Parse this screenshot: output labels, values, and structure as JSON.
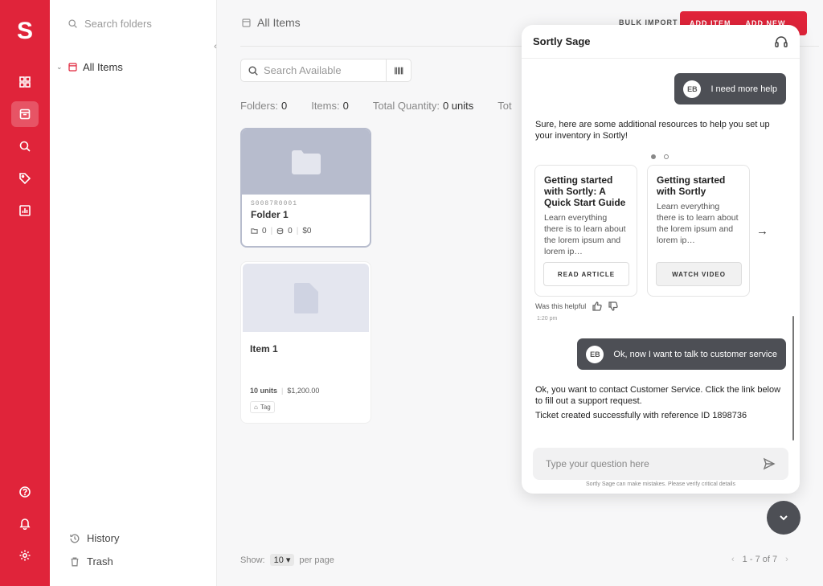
{
  "rail": {
    "logo": "S",
    "icons": [
      "dashboard-icon",
      "items-icon",
      "search-icon",
      "tags-icon",
      "reports-icon",
      "help-icon",
      "notifications-icon",
      "settings-icon"
    ]
  },
  "folders": {
    "search_placeholder": "Search folders",
    "tree_root": "All Items",
    "history": "History",
    "trash": "Trash"
  },
  "main": {
    "title": "All Items",
    "bulk_import": "BULK IMPORT",
    "add_item": "ADD ITEM",
    "add_new": "ADD NEW",
    "search_placeholder": "Search Available",
    "stats": [
      {
        "label": "Folders:",
        "value": "0"
      },
      {
        "label": "Items:",
        "value": "0"
      },
      {
        "label": "Total Quantity:",
        "value": "0 units"
      },
      {
        "label": "Tot",
        "value": ""
      }
    ],
    "cards": [
      {
        "id": "S0087R0001",
        "title": "Folder 1",
        "folders": "0",
        "items": "0",
        "value": "$0"
      },
      {
        "title": "Item 1",
        "units": "10 units",
        "price": "$1,200.00",
        "tag": "Tag"
      }
    ],
    "show_label": "Show:",
    "page_size": "10",
    "per_page": "per page",
    "pagination": "1 - 7 of 7"
  },
  "chat": {
    "title": "Sortly Sage",
    "avatar": "EB",
    "user_msg_1": "I need more help",
    "bot_msg_1": "Sure, here are some additional resources to help you set up your inventory in Sortly!",
    "resources": [
      {
        "title": "Getting started with Sortly: A Quick Start Guide",
        "desc": "Learn everything there is to learn about the lorem ipsum and  lorem ip…",
        "button": "READ ARTICLE"
      },
      {
        "title": "Getting started with Sortly",
        "desc": "Learn everything there is to learn about the lorem ipsum and  lorem ip…",
        "button": "WATCH VIDEO"
      }
    ],
    "helpful": "Was this helpful",
    "time": "1:20 pm",
    "user_msg_2": "Ok, now I want to talk to customer service",
    "bot_msg_2": "Ok, you want to contact Customer Service. Click the link below to fill out a support request.",
    "bot_msg_3": "Ticket created successfully with reference ID 1898736",
    "input_placeholder": "Type your question here",
    "disclaimer": "Sortly Sage can make mistakes. Please verify critical details"
  },
  "colors": {
    "brand": "#e0243a",
    "bubble": "#4d4f55"
  }
}
